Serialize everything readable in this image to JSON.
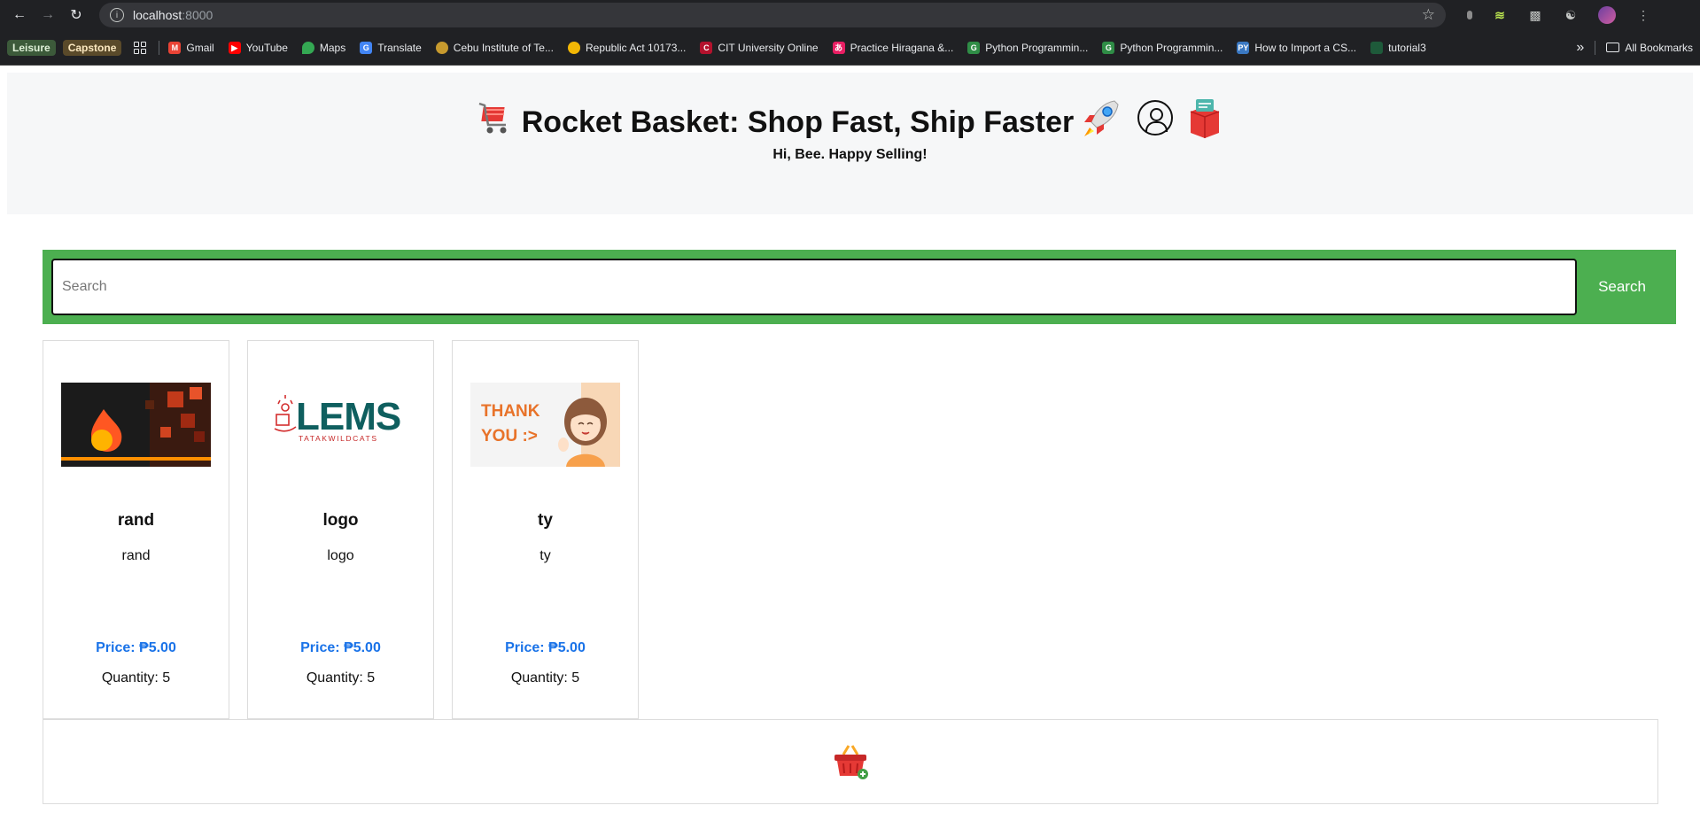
{
  "browser": {
    "url_host": "localhost",
    "url_port": ":8000",
    "bookmarks": {
      "chips": [
        "Leisure",
        "Capstone"
      ],
      "items": [
        {
          "label": "Gmail",
          "color": "#ea4335"
        },
        {
          "label": "YouTube",
          "color": "#ff0000"
        },
        {
          "label": "Maps",
          "color": "#34a853"
        },
        {
          "label": "Translate",
          "color": "#4285f4"
        },
        {
          "label": "Cebu Institute of Te...",
          "color": "#c79a2e"
        },
        {
          "label": "Republic Act 10173...",
          "color": "#f2b705"
        },
        {
          "label": "CIT University Online",
          "color": "#b3122d"
        },
        {
          "label": "Practice Hiragana &...",
          "color": "#e91e63"
        },
        {
          "label": "Python Programmin...",
          "color": "#2f8d46"
        },
        {
          "label": "Python Programmin...",
          "color": "#2f8d46"
        },
        {
          "label": "How to Import a CS...",
          "color": "#3a78c2"
        },
        {
          "label": "tutorial3",
          "color": "#1e5a3a"
        }
      ],
      "overflow": "»",
      "all_bookmarks": "All Bookmarks"
    }
  },
  "header": {
    "title": "Rocket Basket: Shop Fast, Ship Faster",
    "greeting": "Hi, Bee. Happy Selling!"
  },
  "search": {
    "placeholder": "Search",
    "value": "",
    "button_label": "Search"
  },
  "products": [
    {
      "name": "rand",
      "description": "rand",
      "price": "Price: ₱5.00",
      "quantity": "Quantity: 5",
      "image": "flame-abstract-image"
    },
    {
      "name": "logo",
      "description": "logo",
      "price": "Price: ₱5.00",
      "quantity": "Quantity: 5",
      "image": "lems-logo-image",
      "image_text": "LEMS",
      "image_subtext": "TATAKWILDCATS"
    },
    {
      "name": "ty",
      "description": "ty",
      "price": "Price: ₱5.00",
      "quantity": "Quantity: 5",
      "image": "thank-you-image",
      "image_text": "THANK YOU :>"
    }
  ],
  "colors": {
    "accent_green": "#4caf50",
    "price_blue": "#1a73e8"
  }
}
